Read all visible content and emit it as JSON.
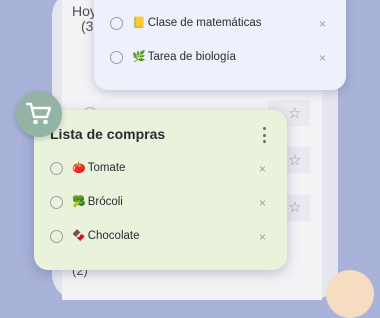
{
  "background": {
    "heading": "Hoy",
    "count_top": "(3",
    "count_bottom": "(2)"
  },
  "school_card": {
    "items": [
      {
        "emoji": "📒",
        "label": "Clase de matemáticas"
      },
      {
        "emoji": "🌿",
        "label": "Tarea de biología"
      }
    ]
  },
  "shopping_card": {
    "title": "Lista de compras",
    "items": [
      {
        "emoji": "🍅",
        "label": "Tomate"
      },
      {
        "emoji": "🥦",
        "label": "Brócoli"
      },
      {
        "emoji": "🍫",
        "label": "Chocolate"
      }
    ]
  },
  "icons": {
    "cart": "shopping-cart-icon",
    "menu": "more-vertical-icon",
    "remove": "close-icon",
    "star": "star-icon"
  },
  "colors": {
    "page_bg": "#a9b2d9",
    "school_card_bg": "#eef1fc",
    "shopping_card_bg": "#e9f3dc",
    "cart_badge_bg": "#93b3a4"
  }
}
